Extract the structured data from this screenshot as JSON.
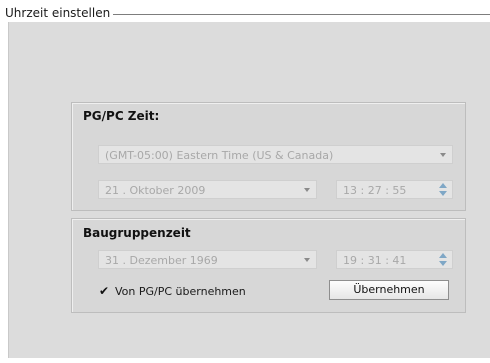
{
  "outer_group": {
    "title": "Uhrzeit einstellen"
  },
  "pgpc_time": {
    "title": "PG/PC Zeit:",
    "timezone": "(GMT-05:00) Eastern Time (US & Canada)",
    "date": "21 . Oktober  2009",
    "time": "13 : 27 : 55"
  },
  "module_time": {
    "title": "Baugruppenzeit",
    "date": "31 . Dezember  1969",
    "time": "19 : 31 : 41",
    "checkbox_label": "Von PG/PC übernehmen",
    "checkbox_checked": true,
    "apply_button": "Übernehmen"
  },
  "colors": {
    "panel_bg": "#dcdcdc",
    "disabled_text": "#a8a8a8",
    "spinner_accent": "#7fa7c6"
  }
}
